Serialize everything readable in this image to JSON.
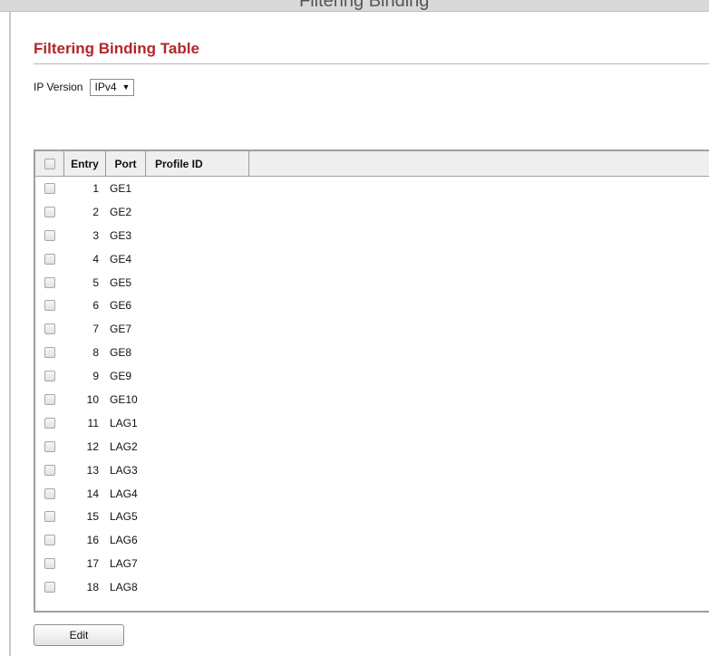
{
  "header": {
    "clipped_title": "Filtering Binding"
  },
  "section": {
    "title": "Filtering Binding Table"
  },
  "ip_version": {
    "label": "IP Version",
    "selected": "IPv4"
  },
  "table": {
    "columns": [
      "Entry",
      "Port",
      "Profile ID"
    ],
    "rows": [
      {
        "entry": "1",
        "port": "GE1",
        "profile": ""
      },
      {
        "entry": "2",
        "port": "GE2",
        "profile": ""
      },
      {
        "entry": "3",
        "port": "GE3",
        "profile": ""
      },
      {
        "entry": "4",
        "port": "GE4",
        "profile": ""
      },
      {
        "entry": "5",
        "port": "GE5",
        "profile": ""
      },
      {
        "entry": "6",
        "port": "GE6",
        "profile": ""
      },
      {
        "entry": "7",
        "port": "GE7",
        "profile": ""
      },
      {
        "entry": "8",
        "port": "GE8",
        "profile": ""
      },
      {
        "entry": "9",
        "port": "GE9",
        "profile": ""
      },
      {
        "entry": "10",
        "port": "GE10",
        "profile": ""
      },
      {
        "entry": "11",
        "port": "LAG1",
        "profile": ""
      },
      {
        "entry": "12",
        "port": "LAG2",
        "profile": ""
      },
      {
        "entry": "13",
        "port": "LAG3",
        "profile": ""
      },
      {
        "entry": "14",
        "port": "LAG4",
        "profile": ""
      },
      {
        "entry": "15",
        "port": "LAG5",
        "profile": ""
      },
      {
        "entry": "16",
        "port": "LAG6",
        "profile": ""
      },
      {
        "entry": "17",
        "port": "LAG7",
        "profile": ""
      },
      {
        "entry": "18",
        "port": "LAG8",
        "profile": ""
      }
    ]
  },
  "buttons": {
    "edit": "Edit"
  },
  "colors": {
    "title_red": "#b3262b",
    "header_bg": "#efefef"
  }
}
